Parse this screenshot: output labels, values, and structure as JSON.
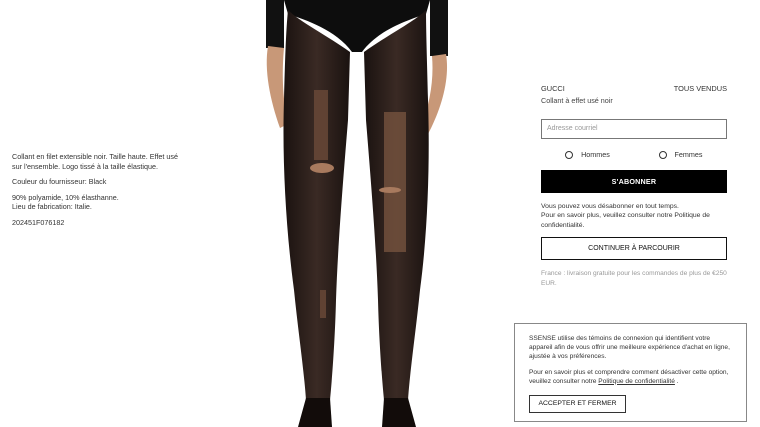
{
  "product": {
    "description": "Collant en filet extensible noir. Taille haute. Effet usé sur l'ensemble. Logo tissé à la taille élastique.",
    "supplier_color": "Couleur du fournisseur: Black",
    "composition": "90% polyamide, 10% élasthanne.",
    "origin": "Lieu de fabrication: Italie.",
    "sku": "202451F076182",
    "brand": "GUCCI",
    "name": "Collant à effet usé noir",
    "stock_status": "TOUS VENDUS"
  },
  "newsletter": {
    "email_placeholder": "Adresse courriel",
    "gender_men": "Hommes",
    "gender_women": "Femmes",
    "subscribe_label": "S'ABONNER",
    "unsubscribe_text": "Vous pouvez vous désabonner en tout temps.",
    "policy_text": "Pour en savoir plus, veuillez consulter notre Politique de confidentialité.",
    "continue_label": "CONTINUER À PARCOURIR",
    "shipping_text": "France : livraison gratuite pour les commandes de plus de €250 EUR."
  },
  "cookie": {
    "text1": "SSENSE utilise des témoins de connexion qui identifient votre appareil afin de vous offrir une meilleure expérience d'achat en ligne, ajustée à vos préférences.",
    "text2_prefix": "Pour en savoir plus et comprendre comment désactiver cette option, veuillez consulter notre",
    "link_label": "Politique de confidentialité",
    "text2_suffix": ".",
    "accept_label": "ACCEPTER ET FERMER"
  },
  "colors": {
    "black": "#000000",
    "skin": "#c89878",
    "tights": "#2a201c"
  }
}
